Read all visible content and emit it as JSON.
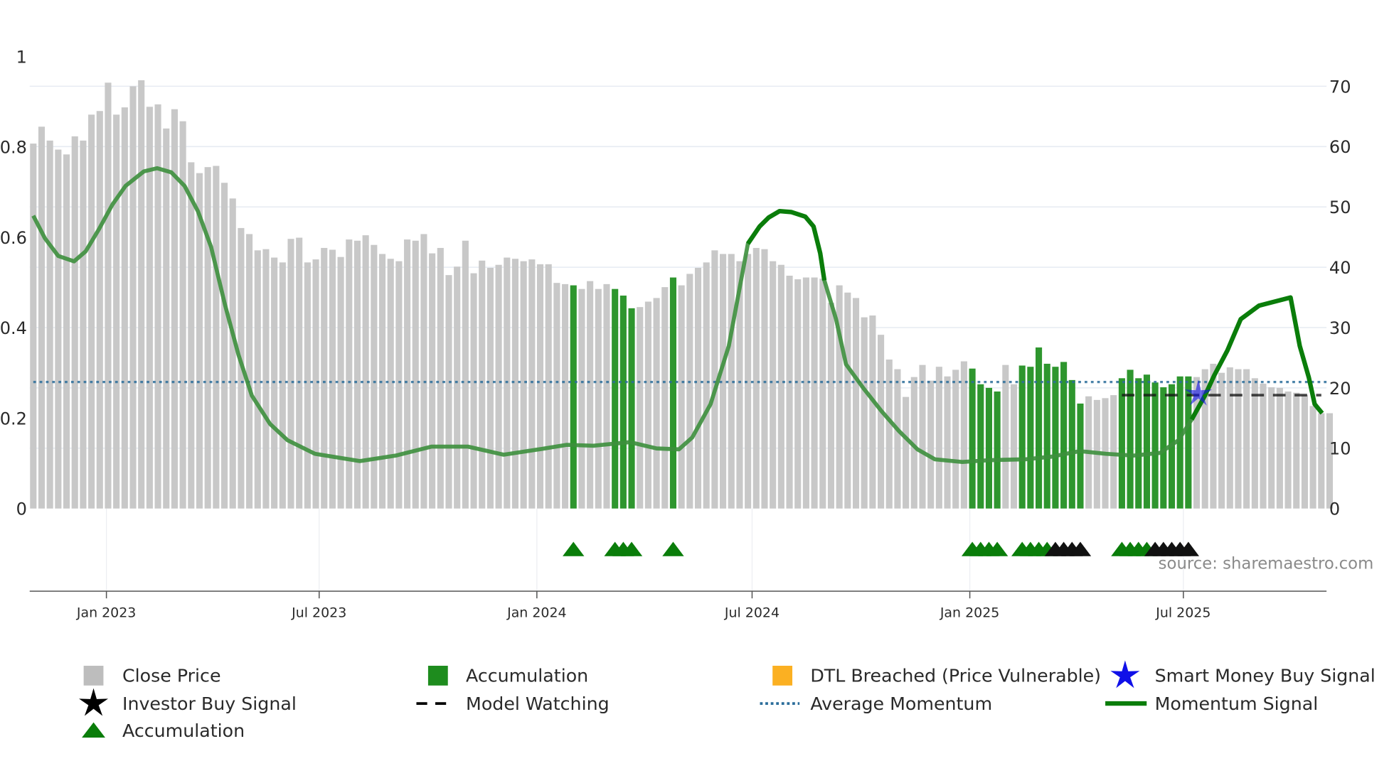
{
  "chart_data": {
    "type": "bar",
    "title": "",
    "colors": {
      "price": "#c8c8c8",
      "accumulation": "#2e962e",
      "momentum": "#0a7d0a",
      "average": "#2c6e9b",
      "watching": "#111111",
      "smart_money": "#1010e8",
      "dtl": "#fbb022",
      "triangle_green": "#0a7d0a",
      "triangle_black": "#111111"
    },
    "left_axis": {
      "ylim": [
        0,
        1
      ],
      "ticks": [
        {
          "v": 0,
          "label": "0"
        },
        {
          "v": 0.2,
          "label": "0.2"
        },
        {
          "v": 0.4,
          "label": "0.4"
        },
        {
          "v": 0.6,
          "label": "0.6"
        },
        {
          "v": 0.8,
          "label": "0.8"
        },
        {
          "v": 1,
          "label": "1"
        }
      ]
    },
    "right_axis": {
      "ylim": [
        0,
        70
      ],
      "ticks": [
        {
          "v": 0,
          "label": "0"
        },
        {
          "v": 10,
          "label": "10"
        },
        {
          "v": 20,
          "label": "20"
        },
        {
          "v": 30,
          "label": "30"
        },
        {
          "v": 40,
          "label": "40"
        },
        {
          "v": 50,
          "label": "50"
        },
        {
          "v": 60,
          "label": "60"
        },
        {
          "v": 70,
          "label": "70"
        }
      ]
    },
    "x_ticks": [
      {
        "week": 8.8,
        "label": "Jan 2023"
      },
      {
        "week": 34.4,
        "label": "Jul 2023"
      },
      {
        "week": 60.6,
        "label": "Jan 2024"
      },
      {
        "week": 86.5,
        "label": "Jul 2024"
      },
      {
        "week": 112.7,
        "label": "Jan 2025"
      },
      {
        "week": 138.4,
        "label": "Jul 2025"
      }
    ],
    "close_price": [
      60.5,
      63.3,
      61,
      59.5,
      58.7,
      61.7,
      61,
      65.3,
      65.9,
      70.6,
      65.3,
      66.5,
      70,
      71,
      66.6,
      67,
      63,
      66.2,
      64.2,
      57.4,
      55.6,
      56.6,
      56.8,
      54,
      51.4,
      46.5,
      45.5,
      42.8,
      43,
      41.6,
      40.8,
      44.7,
      44.9,
      40.8,
      41.3,
      43.2,
      42.9,
      41.7,
      44.6,
      44.4,
      45.3,
      43.7,
      42.2,
      41.4,
      41,
      44.6,
      44.4,
      45.5,
      42.3,
      43.2,
      38.7,
      40.1,
      44.4,
      39,
      41.1,
      39.9,
      40.4,
      41.6,
      41.4,
      41,
      41.3,
      40.5,
      40.5,
      37.4,
      37.2,
      37,
      36.4,
      37.7,
      36.4,
      37.2,
      36.4,
      35.3,
      33.2,
      33.4,
      34.3,
      34.9,
      36.7,
      38.3,
      37,
      38.9,
      39.9,
      40.8,
      42.8,
      42.2,
      42.2,
      41,
      42.2,
      43.2,
      43,
      41,
      40.4,
      38.6,
      38,
      38.3,
      38.3,
      38.1,
      34.1,
      37,
      35.8,
      34.9,
      31.7,
      32,
      28.8,
      24.7,
      23.1,
      18.5,
      21.8,
      23.8,
      21.2,
      23.5,
      21.9,
      23,
      24.4,
      23.2,
      20.6,
      20,
      19.4,
      23.8,
      20.6,
      23.7,
      23.5,
      26.7,
      24,
      23.5,
      24.3,
      21.3,
      17.4,
      18.6,
      18,
      18.3,
      18.8,
      21.6,
      23,
      21.6,
      22.2,
      20.9,
      20.1,
      20.6,
      21.9,
      21.9,
      21.8,
      23.1,
      24,
      22.5,
      23.4,
      23.1,
      23.1,
      21.6,
      20.7,
      20.1,
      20,
      19.4,
      19.2,
      18.8,
      17,
      15.8,
      15.8
    ],
    "accumulation_weeks": [
      65,
      70,
      71,
      72,
      77,
      113,
      114,
      115,
      116,
      119,
      120,
      121,
      122,
      123,
      124,
      125,
      126,
      131,
      132,
      133,
      134,
      135,
      136,
      137,
      138,
      139
    ],
    "accumulation_triangles": {
      "green": [
        65,
        70,
        71,
        72,
        77,
        113,
        114,
        115,
        116,
        119,
        120,
        121,
        122,
        131,
        132,
        133,
        134
      ],
      "black": [
        123,
        124,
        125,
        126,
        135,
        136,
        137,
        138,
        139
      ]
    },
    "momentum": [
      [
        0,
        0.648
      ],
      [
        1.4,
        0.598
      ],
      [
        3,
        0.559
      ],
      [
        4.9,
        0.547
      ],
      [
        6.3,
        0.569
      ],
      [
        7.9,
        0.618
      ],
      [
        9.5,
        0.672
      ],
      [
        11.1,
        0.714
      ],
      [
        13.3,
        0.746
      ],
      [
        14.9,
        0.753
      ],
      [
        16.6,
        0.744
      ],
      [
        18.2,
        0.714
      ],
      [
        19.8,
        0.658
      ],
      [
        21.4,
        0.579
      ],
      [
        23.1,
        0.449
      ],
      [
        24.7,
        0.34
      ],
      [
        26.3,
        0.25
      ],
      [
        28.5,
        0.187
      ],
      [
        30.6,
        0.151
      ],
      [
        33.9,
        0.121
      ],
      [
        39.3,
        0.105
      ],
      [
        43.6,
        0.117
      ],
      [
        47.9,
        0.137
      ],
      [
        52.3,
        0.137
      ],
      [
        56.6,
        0.119
      ],
      [
        60.9,
        0.131
      ],
      [
        64.2,
        0.141
      ],
      [
        67.4,
        0.139
      ],
      [
        71.8,
        0.147
      ],
      [
        75,
        0.133
      ],
      [
        77.7,
        0.131
      ],
      [
        79.3,
        0.157
      ],
      [
        81.5,
        0.231
      ],
      [
        83.7,
        0.36
      ],
      [
        86,
        0.586
      ],
      [
        87.4,
        0.624
      ],
      [
        88.5,
        0.644
      ],
      [
        89.8,
        0.658
      ],
      [
        91.2,
        0.656
      ],
      [
        92.9,
        0.646
      ],
      [
        93.9,
        0.624
      ],
      [
        94.7,
        0.565
      ],
      [
        95.2,
        0.505
      ],
      [
        96.6,
        0.419
      ],
      [
        97.8,
        0.319
      ],
      [
        99.9,
        0.266
      ],
      [
        102.1,
        0.215
      ],
      [
        104.2,
        0.171
      ],
      [
        106.4,
        0.131
      ],
      [
        108.5,
        0.109
      ],
      [
        111.8,
        0.103
      ],
      [
        115,
        0.107
      ],
      [
        119.4,
        0.109
      ],
      [
        122.6,
        0.115
      ],
      [
        125.9,
        0.127
      ],
      [
        129.1,
        0.121
      ],
      [
        132.4,
        0.117
      ],
      [
        135.6,
        0.123
      ],
      [
        137.8,
        0.151
      ],
      [
        139.4,
        0.197
      ],
      [
        141,
        0.25
      ],
      [
        142.1,
        0.294
      ],
      [
        143.7,
        0.35
      ],
      [
        145.3,
        0.419
      ],
      [
        147.5,
        0.449
      ],
      [
        151.3,
        0.467
      ],
      [
        152.4,
        0.36
      ],
      [
        153.5,
        0.29
      ],
      [
        154.2,
        0.231
      ],
      [
        155.1,
        0.211
      ]
    ],
    "momentum_highlight_ranges": [
      [
        86,
        95.2
      ],
      [
        138,
        156
      ]
    ],
    "average_momentum": 0.28,
    "model_watching": {
      "price": 18.8,
      "from_week": 131,
      "to_week": 155
    },
    "smart_money_buy": [
      {
        "week": 140.2,
        "price": 19
      }
    ],
    "legend": [
      {
        "label": "Close Price",
        "icon": "gray-square"
      },
      {
        "label": "Accumulation",
        "icon": "green-square"
      },
      {
        "label": "DTL Breached (Price Vulnerable)",
        "icon": "orange-square"
      },
      {
        "label": "Smart Money Buy Signal",
        "icon": "blue-star"
      },
      {
        "label": "Investor Buy Signal",
        "icon": "black-star"
      },
      {
        "label": "Model Watching",
        "icon": "black-dashes"
      },
      {
        "label": "Average Momentum",
        "icon": "blue-dotted-line"
      },
      {
        "label": "Momentum Signal",
        "icon": "green-line"
      },
      {
        "label": "Accumulation",
        "icon": "green-triangle"
      }
    ],
    "source": "source: sharemaestro.com"
  }
}
